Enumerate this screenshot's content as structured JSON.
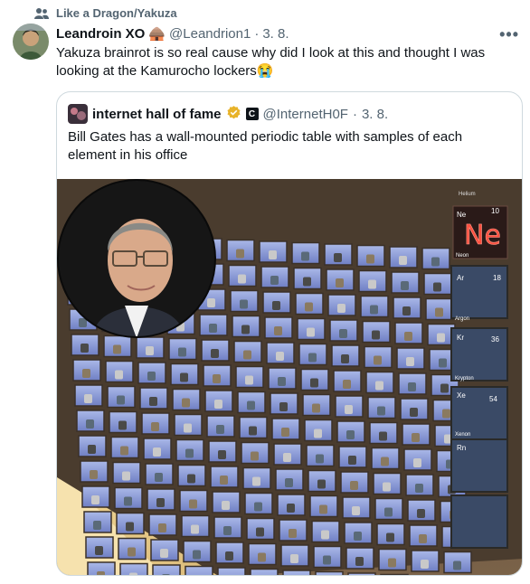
{
  "community": {
    "label": "Like a Dragon/Yakuza",
    "icon": "community-icon"
  },
  "post": {
    "author_name": "Leandroin XO",
    "author_emoji": "🛖",
    "handle": "@Leandrion1",
    "separator": "·",
    "date": "3. 8.",
    "more_label": "•••",
    "text": "Yakuza brainrot is so real cause why did I look at this and thought I was looking at the Kamurocho lockers😭"
  },
  "quoted": {
    "author_name": "internet hall of fame",
    "verified_icon": "verified-badge-icon",
    "affiliate_badge_label": "C",
    "handle": "@InternetH0F",
    "separator": "·",
    "date": "3. 8.",
    "text": "Bill Gates has a wall-mounted periodic table with samples of each element in his office"
  },
  "media": {
    "description_labels": {
      "neon_sign": "Ne",
      "helium": "Helium",
      "neon_label": "Neon",
      "neon_number": "10",
      "argon_symbol": "Ar",
      "argon_number": "18",
      "argon_label": "Argon",
      "krypton_symbol": "Kr",
      "krypton_number": "36",
      "krypton_label": "Krypton",
      "xenon_symbol": "Xe",
      "xenon_number": "54",
      "xenon_label": "Xenon",
      "radon_symbol": "Rn"
    }
  }
}
